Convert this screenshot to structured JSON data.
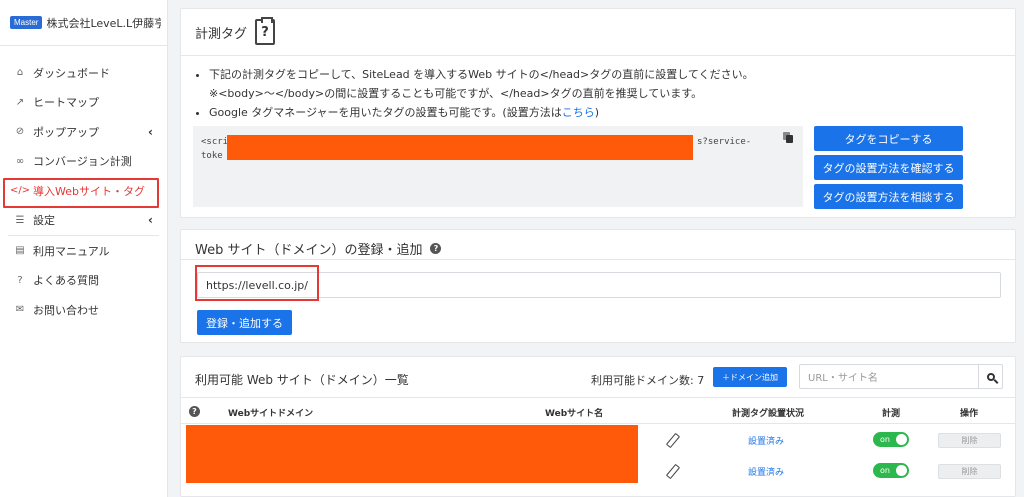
{
  "sidebar": {
    "badge": "Master",
    "company": "株式会社LeveL.L伊藤亨",
    "items": [
      {
        "label": "ダッシュボード",
        "icon": "home-icon"
      },
      {
        "label": "ヒートマップ",
        "icon": "chart-icon"
      },
      {
        "label": "ポップアップ",
        "icon": "paperclip-icon"
      },
      {
        "label": "コンバージョン計測",
        "icon": "link-icon"
      },
      {
        "label": "導入Webサイト・タグ",
        "icon": "code-icon"
      },
      {
        "label": "設定",
        "icon": "list-icon"
      },
      {
        "label": "利用マニュアル",
        "icon": "book-icon"
      },
      {
        "label": "よくある質問",
        "icon": "question-icon"
      },
      {
        "label": "お問い合わせ",
        "icon": "mail-icon"
      }
    ]
  },
  "tag_panel": {
    "title": "計測タグ",
    "bullet1": "下記の計測タグをコピーして、SiteLead を導入するWeb サイトの</head>タグの直前に設置してください。",
    "bullet1_sub": "※<body>〜</body>の間に設置することも可能ですが、</head>タグの直前を推奨しています。",
    "bullet2_prefix": "Google タグマネージャーを用いたタグの設置も可能です。(設置方法は",
    "bullet2_link": "こちら",
    "bullet2_suffix": ")",
    "code_line1_start": "<scri",
    "code_line1_end": "s?service-",
    "code_line2_start": "toke",
    "btn_copy": "タグをコピーする",
    "btn_confirm": "タグの設置方法を確認する",
    "btn_consult": "タグの設置方法を相談する"
  },
  "register_panel": {
    "title": "Web サイト（ドメイン）の登録・追加",
    "input_value": "https://levell.co.jp/",
    "btn_add": "登録・追加する"
  },
  "list_panel": {
    "title": "利用可能 Web サイト（ドメイン）一覧",
    "count_label": "利用可能ドメイン数: 7",
    "btn_add_domain": "＋ドメイン追加",
    "search_placeholder": "URL・サイト名",
    "headers": [
      "Webサイトドメイン",
      "Webサイト名",
      "計測タグ設置状況",
      "計測",
      "操作"
    ],
    "rows": [
      {
        "status": "設置済み",
        "toggle": "on",
        "delete": "削除"
      },
      {
        "status": "設置済み",
        "toggle": "on",
        "delete": "削除"
      }
    ]
  },
  "colors": {
    "accent": "#1a73e8",
    "highlight": "#e53935",
    "redaction": "#ff5a0a",
    "toggle_on": "#2db84d"
  }
}
